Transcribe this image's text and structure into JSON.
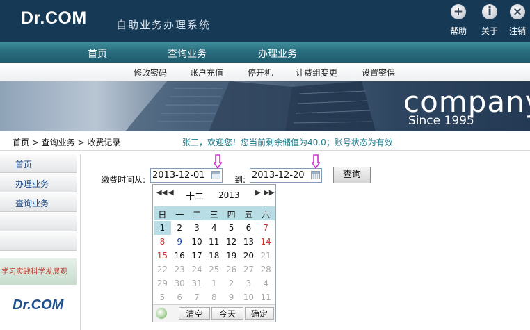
{
  "header": {
    "logo": "Dr.COM",
    "system_name": "自助业务办理系统",
    "buttons": [
      {
        "icon": "plus-icon",
        "glyph": "+",
        "label": "帮助"
      },
      {
        "icon": "info-icon",
        "glyph": "i",
        "label": "关于"
      },
      {
        "icon": "close-icon",
        "glyph": "×",
        "label": "注销"
      }
    ]
  },
  "nav_main": [
    "首页",
    "查询业务",
    "办理业务"
  ],
  "nav_sub": [
    "修改密码",
    "账户充值",
    "停开机",
    "计费组变更",
    "设置密保"
  ],
  "banner": {
    "text": "company",
    "since": "Since 1995"
  },
  "breadcrumb": "首页 > 查询业务 > 收费记录",
  "welcome": "张三，欢迎您！您当前剩余储值为40.0；账号状态为有效",
  "sidebar": {
    "items": [
      "首页",
      "办理业务",
      "查询业务",
      "",
      ""
    ],
    "promo_text": "学习实践科学发展观",
    "logo": "Dr.COM"
  },
  "form": {
    "from_label": "缴费时间从:",
    "from_value": "2013-12-01",
    "to_label": "到:",
    "to_value": "2013-12-20",
    "query_button": "查询"
  },
  "calendar": {
    "month": "十二",
    "year": "2013",
    "weekdays": [
      "日",
      "一",
      "二",
      "三",
      "四",
      "五",
      "六"
    ],
    "weeks": [
      [
        "1",
        "2",
        "3",
        "4",
        "5",
        "6",
        "7"
      ],
      [
        "8",
        "9",
        "10",
        "11",
        "12",
        "13",
        "14"
      ],
      [
        "15",
        "16",
        "17",
        "18",
        "19",
        "20",
        "21"
      ],
      [
        "22",
        "23",
        "24",
        "25",
        "26",
        "27",
        "28"
      ],
      [
        "29",
        "30",
        "31",
        "1",
        "2",
        "3",
        "4"
      ],
      [
        "5",
        "6",
        "7",
        "8",
        "9",
        "10",
        "11"
      ]
    ],
    "selected": "1",
    "buttons": [
      "清空",
      "今天",
      "确定"
    ]
  },
  "colors": {
    "header": "#163a55",
    "nav": "#2a6f80",
    "marker": "#cc33cc",
    "selected_day": "#b9dde4",
    "weekend": "#d0342c"
  }
}
